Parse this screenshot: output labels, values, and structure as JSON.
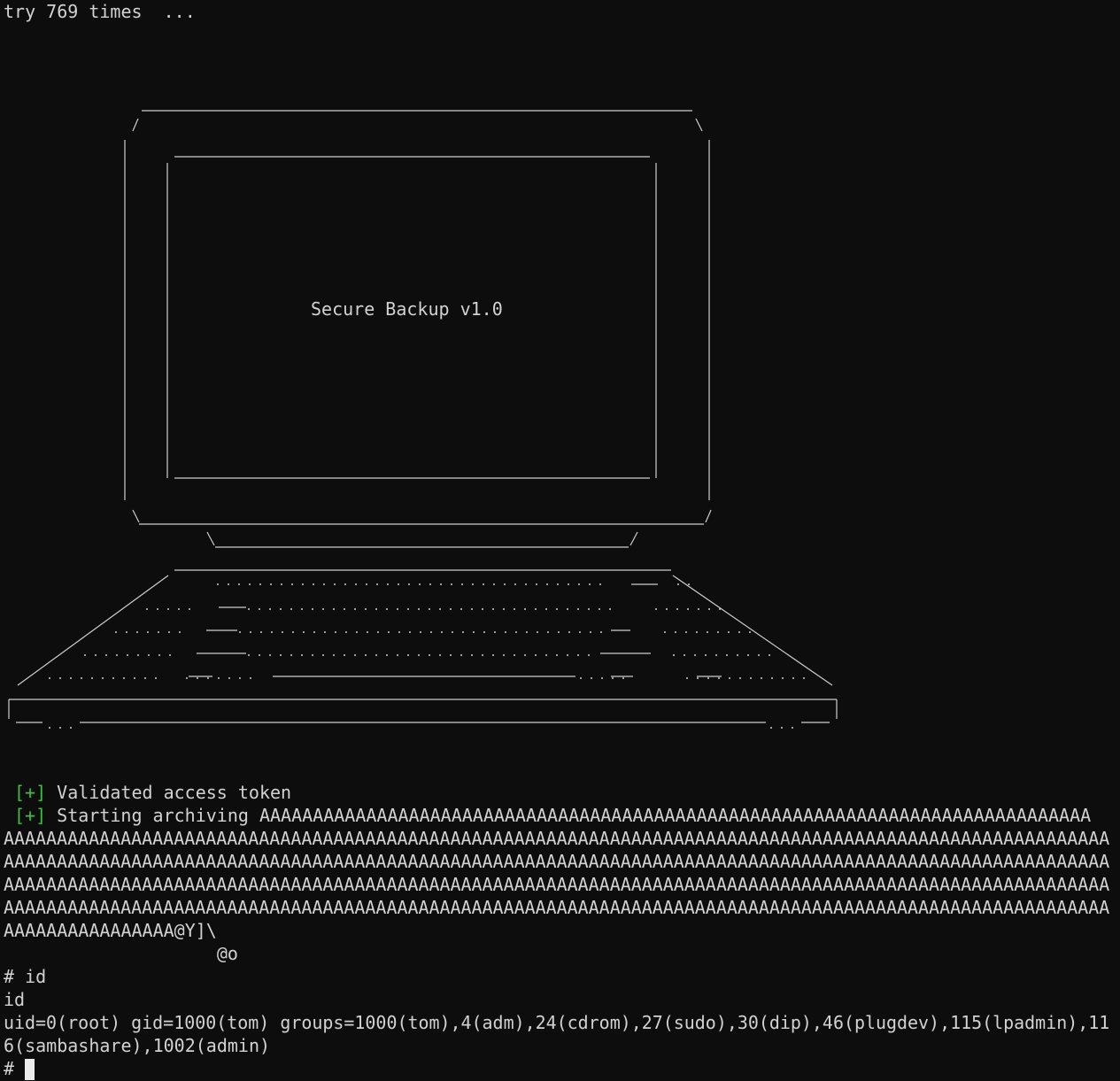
{
  "terminal": {
    "lines": {
      "try": "try 769 times  ...",
      "validated_marker": "[+]",
      "validated_text": "Validated access token",
      "starting_marker": "[+]",
      "starting_text": "Starting archiving AAAAAAAAAAAAAAAAAAAAAAAAAAAAAAAAAAAAAAAAAAAAAAAAAAAAAAAAAAAAAAAAAAAAAAAAAAAAAA",
      "payload_1": "AAAAAAAAAAAAAAAAAAAAAAAAAAAAAAAAAAAAAAAAAAAAAAAAAAAAAAAAAAAAAAAAAAAAAAAAAAAAAAAAAAAAAAAAAAAAAAAAAAAAAAAA",
      "payload_2": "AAAAAAAAAAAAAAAAAAAAAAAAAAAAAAAAAAAAAAAAAAAAAAAAAAAAAAAAAAAAAAAAAAAAAAAAAAAAAAAAAAAAAAAAAAAAAAAAAAAAAAAA",
      "payload_3": "AAAAAAAAAAAAAAAAAAAAAAAAAAAAAAAAAAAAAAAAAAAAAAAAAAAAAAAAAAAAAAAAAAAAAAAAAAAAAAAAAAAAAAAAAAAAAAAAAAAAAAAA",
      "payload_4": "AAAAAAAAAAAAAAAAAAAAAAAAAAAAAAAAAAAAAAAAAAAAAAAAAAAAAAAAAAAAAAAAAAAAAAAAAAAAAAAAAAAAAAAAAAAAAAAAAAAAAAAA",
      "payload_5": "AAAAAAAAAAAAAAAA@Y]\\",
      "payload_6": "                    @o",
      "cmd_id": "# id",
      "echo_id": "id",
      "output_1": "uid=0(root) gid=1000(tom) groups=1000(tom),4(adm),24(cdrom),27(sudo),30(dip),46(plugdev),115(lpadmin),11",
      "output_2": "6(sambashare),1002(admin)",
      "prompt": "#"
    },
    "banner_title": "Secure Backup v1.0",
    "colors": {
      "background": "#0d0d0d",
      "text": "#d2d2d2",
      "marker": "#3fbf3f"
    }
  }
}
